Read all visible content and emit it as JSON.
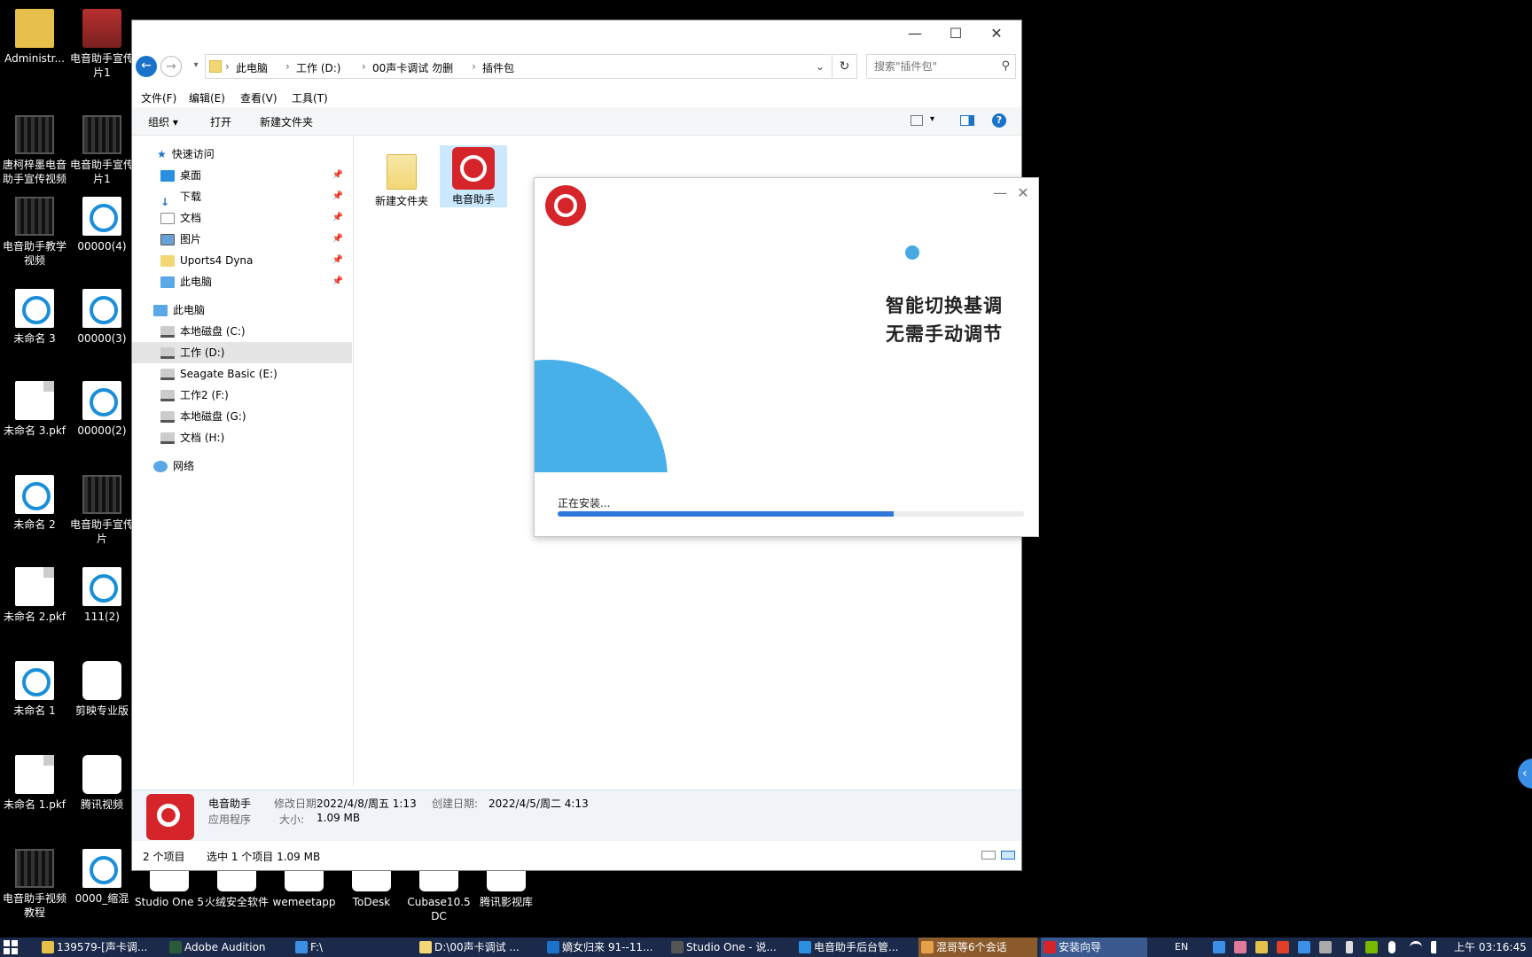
{
  "desktop": {
    "icons": [
      {
        "label": "Administr...",
        "glyph": "user-folder-icon"
      },
      {
        "label": "电音助手宣传片1",
        "glyph": "archive-icon"
      },
      {
        "label": "唐柯梓墨电音助手宣传视频",
        "glyph": "video-icon"
      },
      {
        "label": "电音助手宣传片1",
        "glyph": "video-icon"
      },
      {
        "label": "电音助手教学视频",
        "glyph": "video-icon"
      },
      {
        "label": "00000(4)",
        "glyph": "disc-file-icon"
      },
      {
        "label": "未命名 3",
        "glyph": "disc-file-icon"
      },
      {
        "label": "00000(3)",
        "glyph": "disc-file-icon"
      },
      {
        "label": "未命名 3.pkf",
        "glyph": "document-icon"
      },
      {
        "label": "00000(2)",
        "glyph": "disc-file-icon"
      },
      {
        "label": "未命名 2",
        "glyph": "disc-file-icon"
      },
      {
        "label": "电音助手宣传片",
        "glyph": "video-icon"
      },
      {
        "label": "未命名 2.pkf",
        "glyph": "document-icon"
      },
      {
        "label": "111(2)",
        "glyph": "disc-file-icon"
      },
      {
        "label": "未命名 1",
        "glyph": "disc-file-icon"
      },
      {
        "label": "剪映专业版",
        "glyph": "capcut-icon"
      },
      {
        "label": "未命名 1.pkf",
        "glyph": "document-icon"
      },
      {
        "label": "腾讯视频",
        "glyph": "tencent-video-icon"
      },
      {
        "label": "电音助手视频教程",
        "glyph": "video-icon"
      },
      {
        "label": "0000_缩混",
        "glyph": "disc-file-icon"
      },
      {
        "label": "Studio One 5",
        "glyph": "app-icon"
      },
      {
        "label": "火绒安全软件",
        "glyph": "app-icon"
      },
      {
        "label": "wemeetapp",
        "glyph": "app-icon"
      },
      {
        "label": "ToDesk",
        "glyph": "app-icon"
      },
      {
        "label": "Cubase10.5 DC",
        "glyph": "app-icon"
      },
      {
        "label": "腾讯影视库",
        "glyph": "app-icon"
      }
    ]
  },
  "explorer": {
    "window_buttons": {
      "minimize": "—",
      "maximize": "☐",
      "close": "✕"
    },
    "breadcrumb": [
      "此电脑",
      "工作 (D:)",
      "00声卡调试  勿删",
      "插件包"
    ],
    "search_placeholder": "搜索\"插件包\"",
    "menu": [
      "文件(F)",
      "编辑(E)",
      "查看(V)",
      "工具(T)"
    ],
    "commands": {
      "organize": "组织 ▾",
      "open": "打开",
      "new_folder": "新建文件夹"
    },
    "nav": {
      "quick_access": "快速访问",
      "quick_items": [
        "桌面",
        "下载",
        "文档",
        "图片",
        "Uports4 Dyna",
        "此电脑"
      ],
      "this_pc": "此电脑",
      "drives": [
        "本地磁盘 (C:)",
        "工作 (D:)",
        "Seagate Basic (E:)",
        "工作2 (F:)",
        "本地磁盘 (G:)",
        "文档 (H:)"
      ],
      "network": "网络"
    },
    "files": [
      {
        "name": "新建文件夹",
        "type": "folder"
      },
      {
        "name": "电音助手",
        "type": "app"
      }
    ],
    "details": {
      "name": "电音助手",
      "type": "应用程序",
      "modified_label": "修改日期:",
      "modified_value": "2022/4/8/周五 1:13",
      "created_label": "创建日期:",
      "created_value": "2022/4/5/周二 4:13",
      "size_label": "大小:",
      "size_value": "1.09 MB"
    },
    "status": {
      "count": "2 个项目",
      "selected": "选中 1 个项目  1.09 MB"
    }
  },
  "installer": {
    "minimize": "—",
    "close": "✕",
    "slogan_line1": "智能切换基调",
    "slogan_line2": "无需手动调节",
    "status": "正在安装...",
    "progress": 0.72,
    "brand_color": "#d5252b",
    "accent_color": "#48b0e8"
  },
  "taskbar": {
    "items": [
      {
        "label": "139579-[声卡调...",
        "tone": "normal"
      },
      {
        "label": "Adobe Audition",
        "tone": "normal"
      },
      {
        "label": "F:\\",
        "tone": "normal"
      },
      {
        "label": "D:\\00声卡调试 ...",
        "tone": "normal"
      },
      {
        "label": "嫡女归来 91--11...",
        "tone": "normal"
      },
      {
        "label": "Studio One - 说...",
        "tone": "normal"
      },
      {
        "label": "电音助手后台管...",
        "tone": "normal"
      },
      {
        "label": "混哥等6个会话",
        "tone": "warm"
      },
      {
        "label": "安装向导",
        "tone": "active"
      }
    ],
    "language": "EN",
    "clock": "上午 03:16:45"
  }
}
